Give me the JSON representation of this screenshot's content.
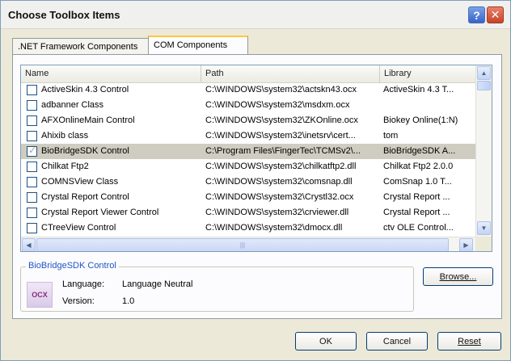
{
  "window": {
    "title": "Choose Toolbox Items",
    "help_label": "?",
    "close_label": "✕"
  },
  "tabs": [
    {
      "label": ".NET Framework Components"
    },
    {
      "label": "COM Components"
    }
  ],
  "list": {
    "headers": {
      "name": "Name",
      "path": "Path",
      "library": "Library"
    },
    "rows": [
      {
        "name": "ActiveSkin 4.3 Control",
        "path": "C:\\WINDOWS\\system32\\actskn43.ocx",
        "library": "ActiveSkin 4.3 T..."
      },
      {
        "name": "adbanner Class",
        "path": "C:\\WINDOWS\\system32\\msdxm.ocx",
        "library": ""
      },
      {
        "name": "AFXOnlineMain Control",
        "path": "C:\\WINDOWS\\system32\\ZKOnline.ocx",
        "library": "Biokey Online(1:N)"
      },
      {
        "name": "Ahixib class",
        "path": "C:\\WINDOWS\\system32\\inetsrv\\cert...",
        "library": "tom"
      },
      {
        "name": "BioBridgeSDK Control",
        "path": "C:\\Program Files\\FingerTec\\TCMSv2\\...",
        "library": "BioBridgeSDK A..."
      },
      {
        "name": "Chilkat Ftp2",
        "path": "C:\\WINDOWS\\system32\\chilkatftp2.dll",
        "library": "Chilkat Ftp2 2.0.0"
      },
      {
        "name": "COMNSView Class",
        "path": "C:\\WINDOWS\\system32\\comsnap.dll",
        "library": "ComSnap 1.0 T..."
      },
      {
        "name": "Crystal Report Control",
        "path": "C:\\WINDOWS\\system32\\Crystl32.ocx",
        "library": "Crystal Report ..."
      },
      {
        "name": "Crystal Report Viewer Control",
        "path": "C:\\WINDOWS\\system32\\crviewer.dll",
        "library": "Crystal Report ..."
      },
      {
        "name": "CTreeView Control",
        "path": "C:\\WINDOWS\\system32\\dmocx.dll",
        "library": "ctv OLE Control..."
      }
    ],
    "selected_index": 4,
    "checked_index": 4
  },
  "details": {
    "group_title": "BioBridgeSDK Control",
    "icon_text": "OCX",
    "language_label": "Language:",
    "language_value": "Language Neutral",
    "version_label": "Version:",
    "version_value": "1.0"
  },
  "buttons": {
    "browse": "Browse...",
    "ok": "OK",
    "cancel": "Cancel",
    "reset": "Reset"
  }
}
